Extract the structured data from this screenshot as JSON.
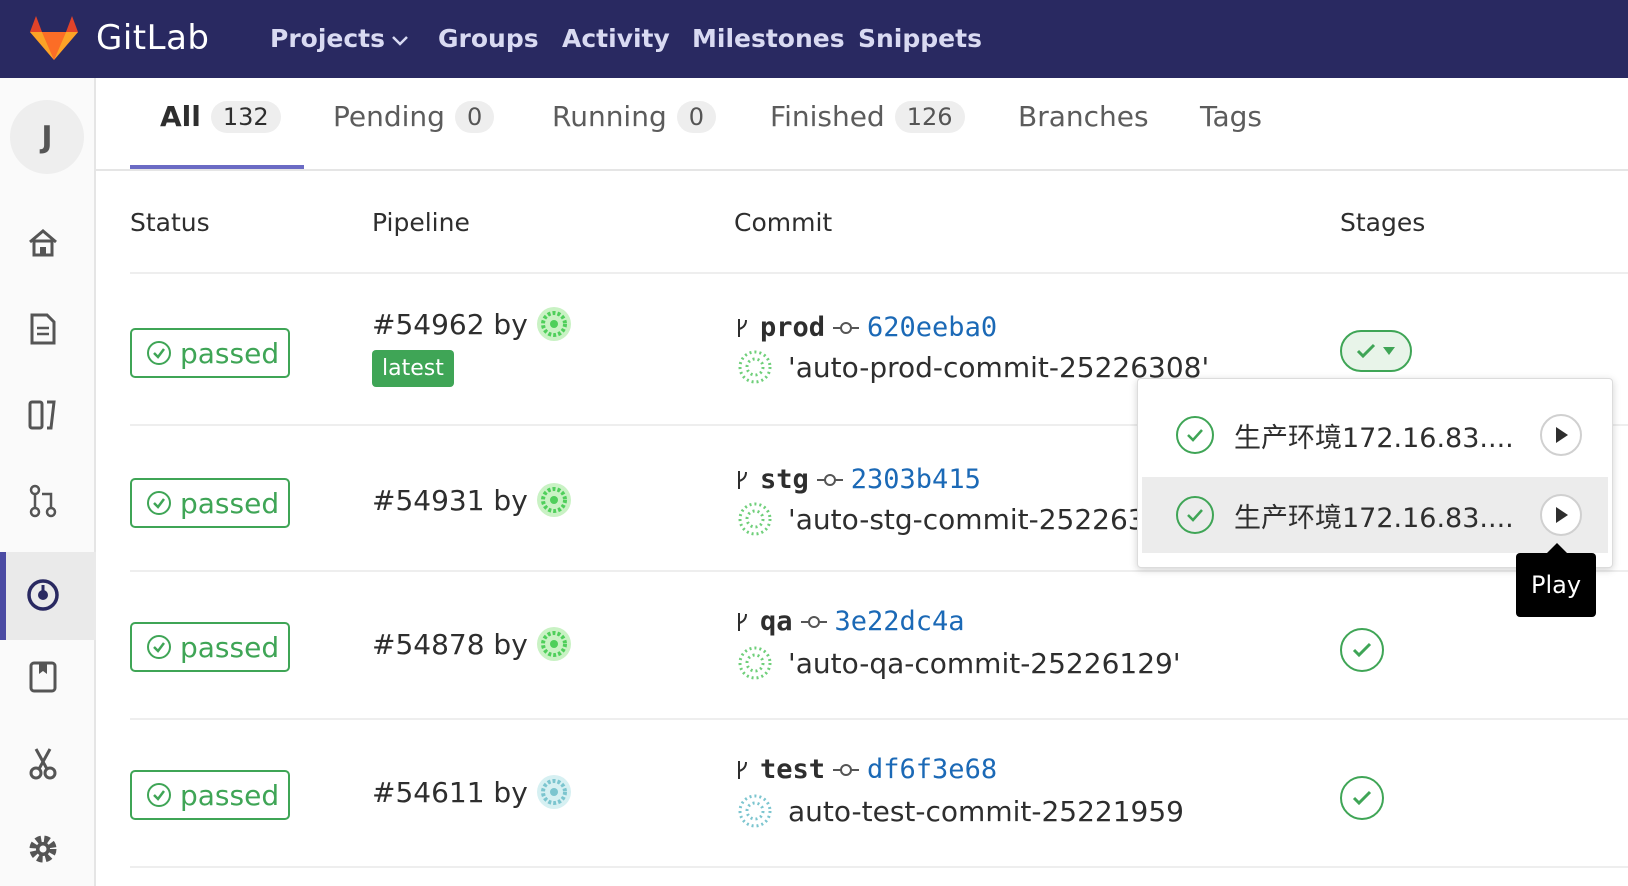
{
  "brand": {
    "name": "GitLab"
  },
  "nav": {
    "projects": "Projects",
    "groups": "Groups",
    "activity": "Activity",
    "milestones": "Milestones",
    "snippets": "Snippets"
  },
  "sidebar": {
    "avatar_letter": "J",
    "items": [
      "home-icon",
      "file-icon",
      "board-icon",
      "merge-request-icon",
      "pipelines-icon",
      "wiki-icon",
      "snippets-icon",
      "settings-icon"
    ],
    "active": "pipelines-icon"
  },
  "tabs": [
    {
      "label": "All",
      "count": "132"
    },
    {
      "label": "Pending",
      "count": "0"
    },
    {
      "label": "Running",
      "count": "0"
    },
    {
      "label": "Finished",
      "count": "126"
    },
    {
      "label": "Branches"
    },
    {
      "label": "Tags"
    }
  ],
  "table": {
    "headers": {
      "status": "Status",
      "pipeline": "Pipeline",
      "commit": "Commit",
      "stages": "Stages"
    },
    "rows": [
      {
        "status": "passed",
        "pipeline": "#54962 by",
        "latest": "latest",
        "branch": "prod",
        "sha": "620eeba0",
        "message": "'auto-prod-commit-25226308'"
      },
      {
        "status": "passed",
        "pipeline": "#54931 by",
        "branch": "stg",
        "sha": "2303b415",
        "message": "'auto-stg-commit-252263"
      },
      {
        "status": "passed",
        "pipeline": "#54878 by",
        "branch": "qa",
        "sha": "3e22dc4a",
        "message": "'auto-qa-commit-25226129'"
      },
      {
        "status": "passed",
        "pipeline": "#54611 by",
        "branch": "test",
        "sha": "df6f3e68",
        "message": "auto-test-commit-25221959"
      }
    ]
  },
  "dropdown": {
    "items": [
      {
        "label": "生产环境172.16.83...."
      },
      {
        "label": "生产环境172.16.83...."
      }
    ],
    "tooltip": "Play"
  },
  "colors": {
    "nav_bg": "#292961",
    "success": "#3fa556",
    "sha_link": "#1b69b6",
    "active_tab": "#6b6bc4"
  }
}
